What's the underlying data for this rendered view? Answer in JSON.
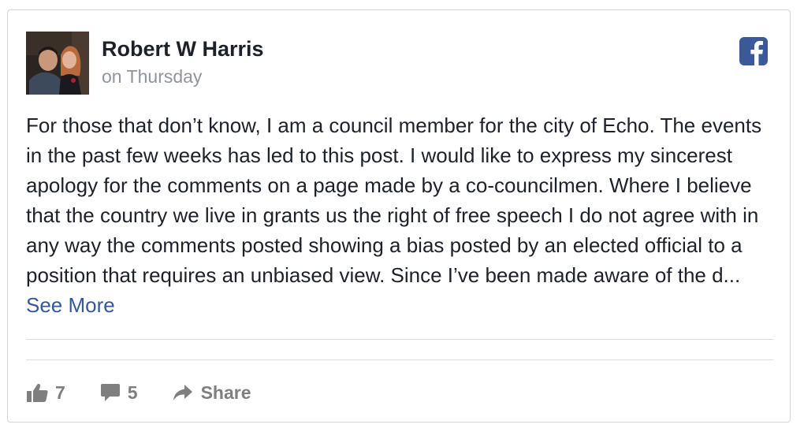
{
  "post": {
    "author": "Robert W Harris",
    "time": "on Thursday",
    "network_icon": "facebook-icon",
    "body": "For those that don’t know, I am a council member for the city of Echo. The events in the past few weeks has led to this post. I would like to express my sincerest apology for the comments on a page made by a co-councilmen. Where I believe that the country we live in grants us the right of free speech I do not agree with in any way the comments posted showing a bias posted by an elected official to a position that requires an unbiased view. Since I’ve been made aware of the d...",
    "see_more": "See More"
  },
  "actions": {
    "likes": "7",
    "comments": "5",
    "share": "Share"
  },
  "colors": {
    "facebook_blue": "#3b5998",
    "link": "#365899",
    "text": "#1d2129",
    "muted": "#90949c",
    "action_gray": "#7f7f7f"
  }
}
